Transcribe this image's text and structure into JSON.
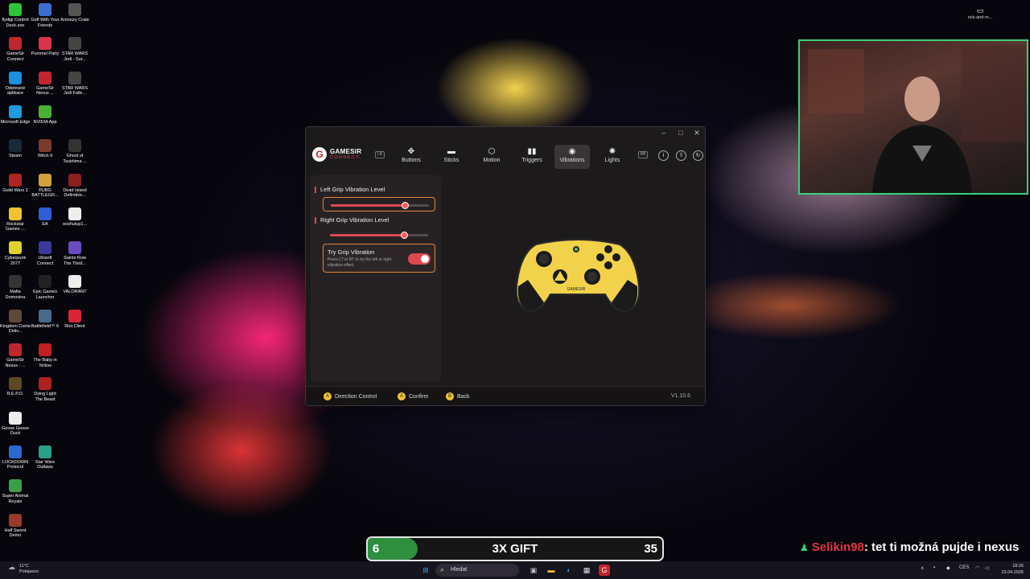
{
  "desktop": {
    "icons": [
      {
        "label": "flydigi Control Deck.exe",
        "color": "#2ec43a"
      },
      {
        "label": "Golf With Your Friends",
        "color": "#3a6fd0"
      },
      {
        "label": "Armoury Crate",
        "color": "#555555"
      },
      {
        "label": "GameSir Connect",
        "color": "#c0262d"
      },
      {
        "label": "Pummel Party",
        "color": "#d9354a"
      },
      {
        "label": "STAR WARS Jedi - Sur...",
        "color": "#444444"
      },
      {
        "label": "Odebrané aplikace",
        "color": "#1b8fe0"
      },
      {
        "label": "GameSir Nexus ...",
        "color": "#c0262d"
      },
      {
        "label": "STAR WARS Jedi Falle...",
        "color": "#444444"
      },
      {
        "label": "Microsoft Edge",
        "color": "#1e9be0"
      },
      {
        "label": "NVIDIA App",
        "color": "#4caf35"
      },
      {
        "label": "Steam",
        "color": "#1b2838"
      },
      {
        "label": "Witch It",
        "color": "#7a3b2a"
      },
      {
        "label": "Ghost of Tsushima ...",
        "color": "#333333"
      },
      {
        "label": "Guild Wars 2",
        "color": "#b22222"
      },
      {
        "label": "PUBG BATTLEGR...",
        "color": "#d1a23a"
      },
      {
        "label": "Dead Island Definitive...",
        "color": "#8a2020"
      },
      {
        "label": "Rockstar Games ...",
        "color": "#f2c230"
      },
      {
        "label": "EA",
        "color": "#2d5fd6"
      },
      {
        "label": "ooshutup1...",
        "color": "#eeeeee"
      },
      {
        "label": "Cyberpunk 2077",
        "color": "#e0d030"
      },
      {
        "label": "Ubisoft Connect",
        "color": "#3a3a9a"
      },
      {
        "label": "Saints Row The Third...",
        "color": "#6a4cc0"
      },
      {
        "label": "Mafia Domovina",
        "color": "#333333"
      },
      {
        "label": "Epic Games Launcher",
        "color": "#222222"
      },
      {
        "label": "VALORANT",
        "color": "#eeeeee"
      },
      {
        "label": "Kingdom Come Deliv...",
        "color": "#5a4a3a"
      },
      {
        "label": "Battlefield™ 6",
        "color": "#4a6a8a"
      },
      {
        "label": "Riot Client",
        "color": "#d8253a"
      },
      {
        "label": "GameSir Nexus - ...",
        "color": "#c0262d"
      },
      {
        "label": "The Baby in Yellow",
        "color": "#c02020"
      },
      {
        "label": "R.E.P.O.",
        "color": "#5a4a20"
      },
      {
        "label": "Dying Light The Beast",
        "color": "#b02020"
      },
      {
        "label": "Goose Goose Duck",
        "color": "#eeeeee"
      },
      {
        "label": "LOCKDOWN Protocol",
        "color": "#2a6ad0"
      },
      {
        "label": "Star Wars Outlaws",
        "color": "#2aa08a"
      },
      {
        "label": "Super Animal Royale",
        "color": "#3aa04a"
      },
      {
        "label": "Half Sword Demo",
        "color": "#9a3a2a"
      }
    ]
  },
  "app": {
    "brand": {
      "name": "GAMESIR",
      "sub": "CONNECT",
      "letter": "G"
    },
    "nav_left": "LB",
    "nav_right": "RB",
    "tabs": [
      {
        "label": "Buttons",
        "icon": "✥"
      },
      {
        "label": "Sticks",
        "icon": "▬"
      },
      {
        "label": "Motion",
        "icon": "⬡"
      },
      {
        "label": "Triggers",
        "icon": "▮▮"
      },
      {
        "label": "Vibrations",
        "icon": "◉"
      },
      {
        "label": "Lights",
        "icon": "✺"
      }
    ],
    "active_tab": "Vibrations",
    "header_icons": {
      "info": "i",
      "upload": "⇧",
      "refresh": "↻"
    },
    "window_controls": {
      "minimize": "–",
      "maximize": "□",
      "close": "✕"
    },
    "settings": {
      "left_grip": {
        "label": "Left Grip Vibration Level",
        "value": 0.75
      },
      "right_grip": {
        "label": "Right Grip Vibration Level",
        "value": 0.75
      },
      "try": {
        "title": "Try Grip Vibration",
        "description": "Press LT or RT to try the left or right vibration effect.",
        "enabled": true
      }
    },
    "controller": {
      "brand": "GAMESIR"
    },
    "footer": {
      "direction": {
        "badge": "A",
        "label": "Direction Control"
      },
      "confirm": {
        "badge": "A",
        "label": "Confirm"
      },
      "back": {
        "badge": "B",
        "label": "Back"
      },
      "version": "V1.10.6"
    },
    "accent": "#e0474e",
    "focus_color": "#e0833d"
  },
  "webcam": {
    "tray_user": "rick-and-m..."
  },
  "gift_bar": {
    "left": "6",
    "title": "3X GIFT",
    "right": "35",
    "progress": 0.17
  },
  "chat": {
    "username": "Selikin98",
    "message": ": tet ti možná pujde i nexus"
  },
  "taskbar": {
    "weather_temp": "11°C",
    "weather_desc": "Polojasno",
    "search_placeholder": "Hledat",
    "lang": "CES",
    "time": "18:26",
    "date": "23.04.2026"
  }
}
